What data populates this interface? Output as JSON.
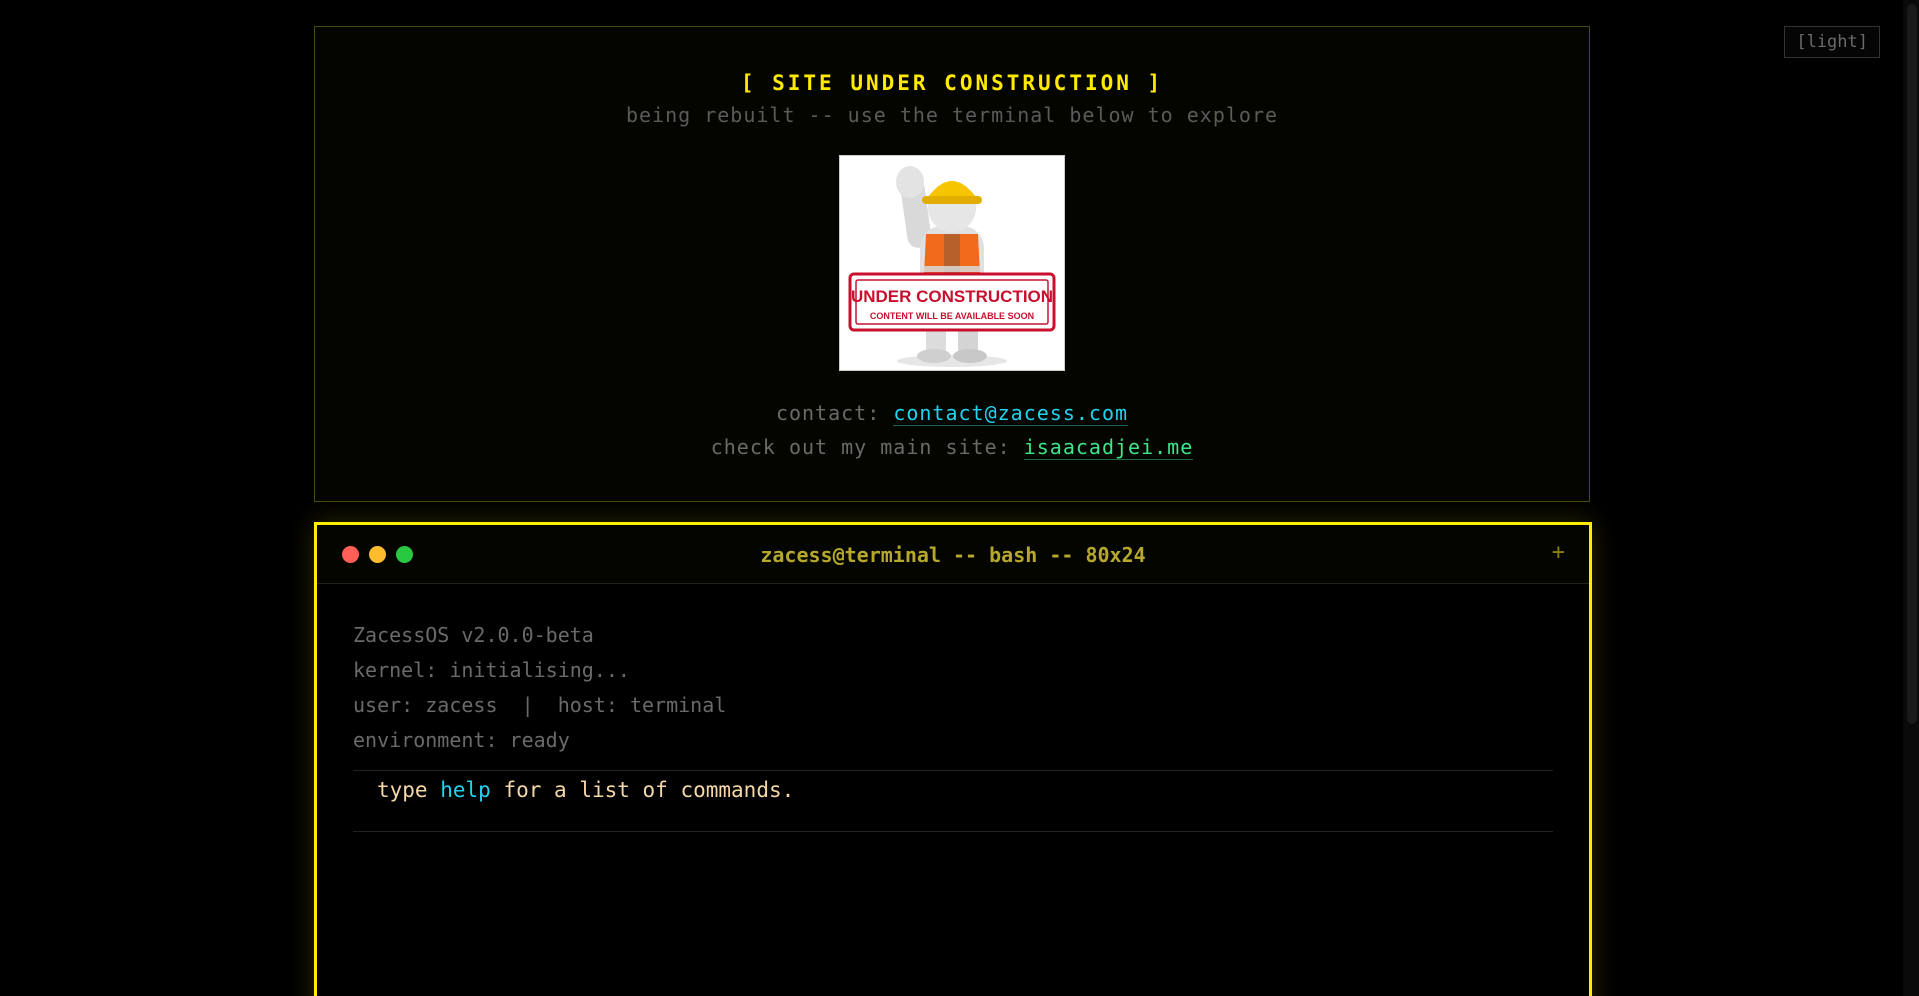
{
  "theme_toggle": {
    "label": "[light]"
  },
  "banner": {
    "title": "[ SITE UNDER CONSTRUCTION ]",
    "subtitle": "being rebuilt -- use the terminal below to explore",
    "image": {
      "main_text": "UNDER CONSTRUCTION",
      "sub_text": "CONTENT WILL BE AVAILABLE SOON"
    },
    "contact_label": "contact:",
    "contact_email": "contact@zacess.com",
    "site_label": "check out my main site:",
    "site_link": "isaacadjei.me"
  },
  "terminal": {
    "title": "zacess@terminal -- bash -- 80x24",
    "new_tab_label": "+",
    "boot_lines": [
      "ZacessOS v2.0.0-beta",
      "kernel: initialising...",
      "user: zacess  |  host: terminal",
      "environment: ready"
    ],
    "hint_prefix": "type",
    "hint_command": "help",
    "hint_suffix": "for a list of commands."
  },
  "colors": {
    "accent": "#ffee00",
    "link_cyan": "#22d3ee",
    "link_green": "#3ee68a"
  }
}
